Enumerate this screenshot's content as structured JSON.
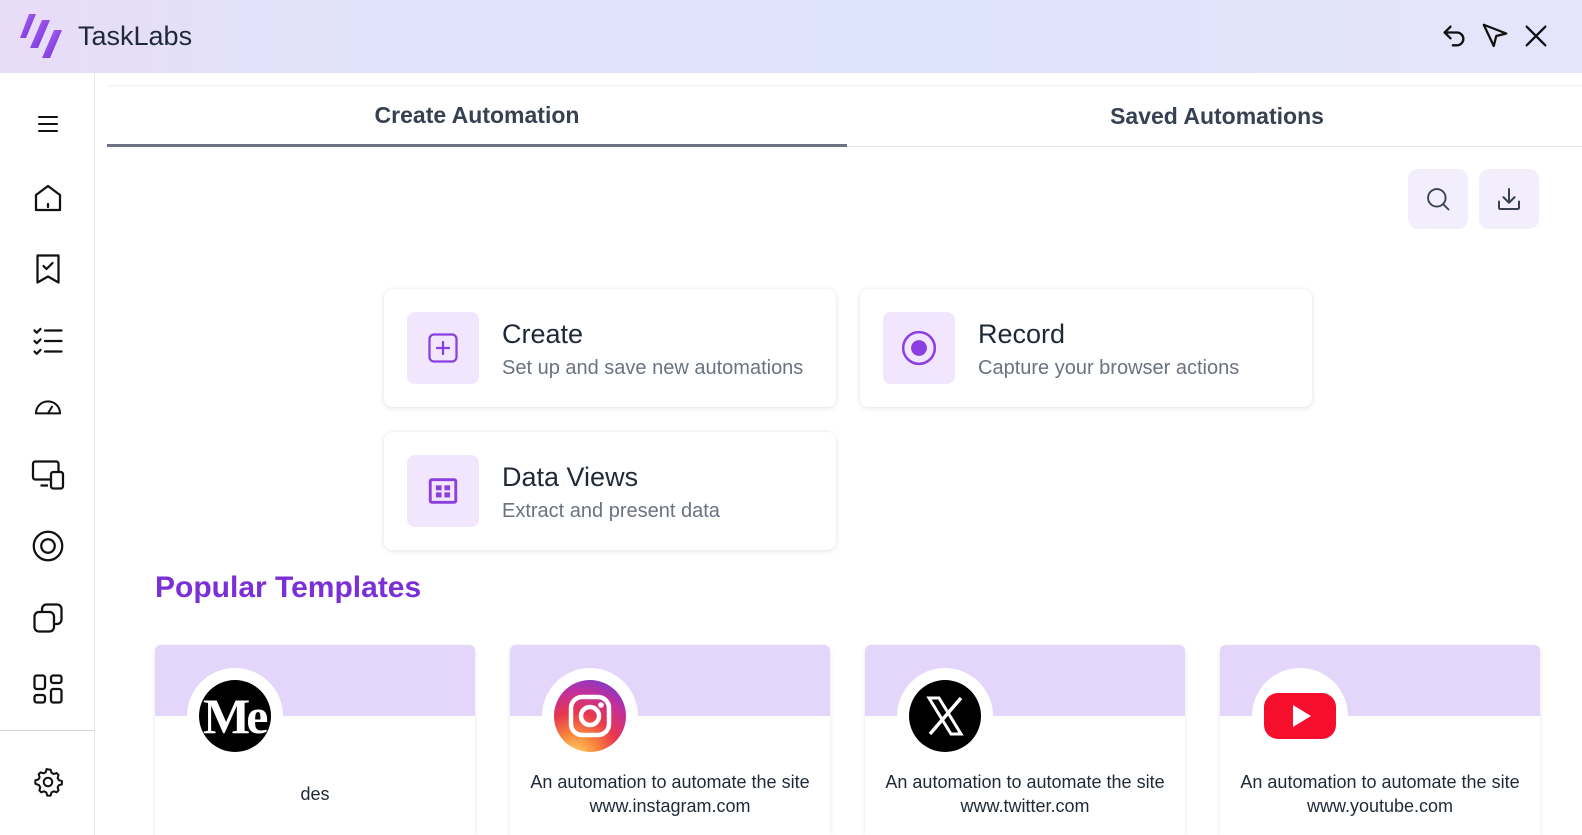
{
  "app": {
    "title": "TaskLabs"
  },
  "window_controls": {
    "back_icon": "undo-icon",
    "send_icon": "send-icon",
    "close_icon": "close-icon"
  },
  "sidebar": {
    "items": [
      {
        "icon": "menu-icon"
      },
      {
        "icon": "home-icon"
      },
      {
        "icon": "bookmark-check-icon"
      },
      {
        "icon": "checklist-icon"
      },
      {
        "icon": "gauge-icon"
      },
      {
        "icon": "devices-icon"
      },
      {
        "icon": "record-icon"
      },
      {
        "icon": "copy-icon"
      },
      {
        "icon": "dashboard-icon"
      },
      {
        "icon": "settings-icon"
      }
    ]
  },
  "tabs": [
    {
      "label": "Create Automation",
      "active": true
    },
    {
      "label": "Saved Automations",
      "active": false
    }
  ],
  "toolbar": {
    "search_icon": "search-icon",
    "download_icon": "download-icon"
  },
  "cards": [
    {
      "title": "Create",
      "subtitle": "Set up and save new automations",
      "icon": "plus-square-icon"
    },
    {
      "title": "Record",
      "subtitle": "Capture your browser actions",
      "icon": "record-icon"
    },
    {
      "title": "Data Views",
      "subtitle": "Extract and present data",
      "icon": "table-icon"
    }
  ],
  "templates": {
    "title": "Popular Templates",
    "items": [
      {
        "logo": "medium-logo",
        "logo_text": "Me",
        "description": "des"
      },
      {
        "logo": "instagram-logo",
        "description": "An automation to automate the site www.instagram.com"
      },
      {
        "logo": "x-twitter-logo",
        "description": "An automation to automate the site www.twitter.com"
      },
      {
        "logo": "youtube-logo",
        "description": "An automation to automate the site www.youtube.com"
      }
    ]
  },
  "colors": {
    "accent": "#7b2fd6",
    "icon_purple": "#8b3fe0",
    "template_band": "#e3d6fa",
    "card_icon_bg": "#f1e6fd"
  }
}
